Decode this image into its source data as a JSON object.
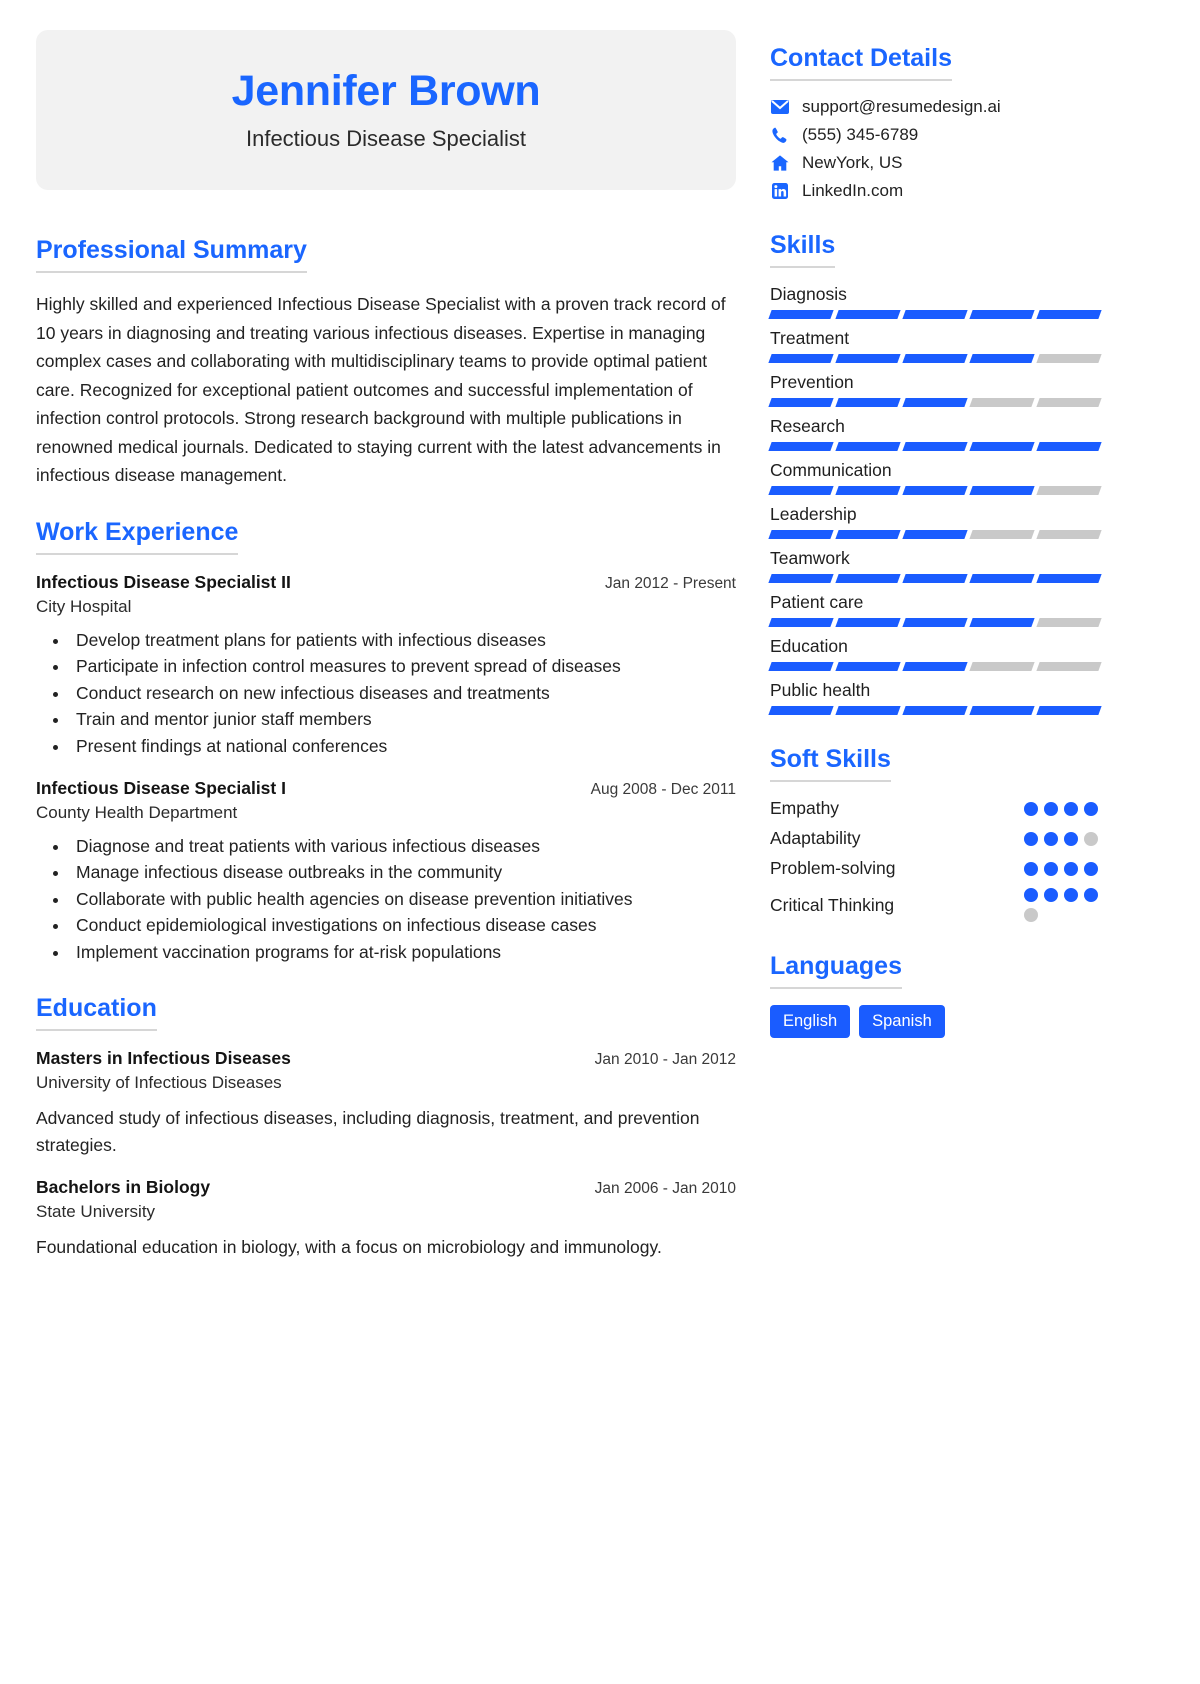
{
  "header": {
    "name": "Jennifer Brown",
    "job_title": "Infectious Disease Specialist"
  },
  "colors": {
    "accent": "#1a66ff",
    "bar_filled": "#1a5cff",
    "bar_empty": "#c9c9c9",
    "card_bg": "#f2f2f2"
  },
  "sections": {
    "summary_heading": "Professional Summary",
    "work_heading": "Work Experience",
    "education_heading": "Education",
    "contact_heading": "Contact Details",
    "skills_heading": "Skills",
    "soft_skills_heading": "Soft Skills",
    "languages_heading": "Languages"
  },
  "summary": {
    "text": "Highly skilled and experienced Infectious Disease Specialist with a proven track record of 10 years in diagnosing and treating various infectious diseases. Expertise in managing complex cases and collaborating with multidisciplinary teams to provide optimal patient care. Recognized for exceptional patient outcomes and successful implementation of infection control protocols. Strong research background with multiple publications in renowned medical journals. Dedicated to staying current with the latest advancements in infectious disease management."
  },
  "work": [
    {
      "title": "Infectious Disease Specialist II",
      "date": "Jan 2012 - Present",
      "org": "City Hospital",
      "bullets": [
        "Develop treatment plans for patients with infectious diseases",
        "Participate in infection control measures to prevent spread of diseases",
        "Conduct research on new infectious diseases and treatments",
        "Train and mentor junior staff members",
        "Present findings at national conferences"
      ]
    },
    {
      "title": "Infectious Disease Specialist I",
      "date": "Aug 2008 - Dec 2011",
      "org": "County Health Department",
      "bullets": [
        "Diagnose and treat patients with various infectious diseases",
        "Manage infectious disease outbreaks in the community",
        "Collaborate with public health agencies on disease prevention initiatives",
        "Conduct epidemiological investigations on infectious disease cases",
        "Implement vaccination programs for at-risk populations"
      ]
    }
  ],
  "education": [
    {
      "title": "Masters in Infectious Diseases",
      "date": "Jan 2010 - Jan 2012",
      "org": "University of Infectious Diseases",
      "desc": "Advanced study of infectious diseases, including diagnosis, treatment, and prevention strategies."
    },
    {
      "title": "Bachelors in Biology",
      "date": "Jan 2006 - Jan 2010",
      "org": "State University",
      "desc": "Foundational education in biology, with a focus on microbiology and immunology."
    }
  ],
  "contact": [
    {
      "icon": "email-icon",
      "value": "support@resumedesign.ai"
    },
    {
      "icon": "phone-icon",
      "value": "(555) 345-6789"
    },
    {
      "icon": "home-icon",
      "value": "NewYork, US"
    },
    {
      "icon": "linkedin-icon",
      "value": "LinkedIn.com"
    }
  ],
  "skills": [
    {
      "name": "Diagnosis",
      "level": 5,
      "max": 5
    },
    {
      "name": "Treatment",
      "level": 4,
      "max": 5
    },
    {
      "name": "Prevention",
      "level": 3,
      "max": 5
    },
    {
      "name": "Research",
      "level": 5,
      "max": 5
    },
    {
      "name": "Communication",
      "level": 4,
      "max": 5
    },
    {
      "name": "Leadership",
      "level": 3,
      "max": 5
    },
    {
      "name": "Teamwork",
      "level": 5,
      "max": 5
    },
    {
      "name": "Patient care",
      "level": 4,
      "max": 5
    },
    {
      "name": "Education",
      "level": 3,
      "max": 5
    },
    {
      "name": "Public health",
      "level": 5,
      "max": 5
    }
  ],
  "soft_skills": [
    {
      "name": "Empathy",
      "level": 4,
      "max": 4
    },
    {
      "name": "Adaptability",
      "level": 3,
      "max": 4
    },
    {
      "name": "Problem-solving",
      "level": 4,
      "max": 4
    },
    {
      "name": "Critical Thinking",
      "level": 4,
      "max": 5
    }
  ],
  "languages": [
    "English",
    "Spanish"
  ]
}
